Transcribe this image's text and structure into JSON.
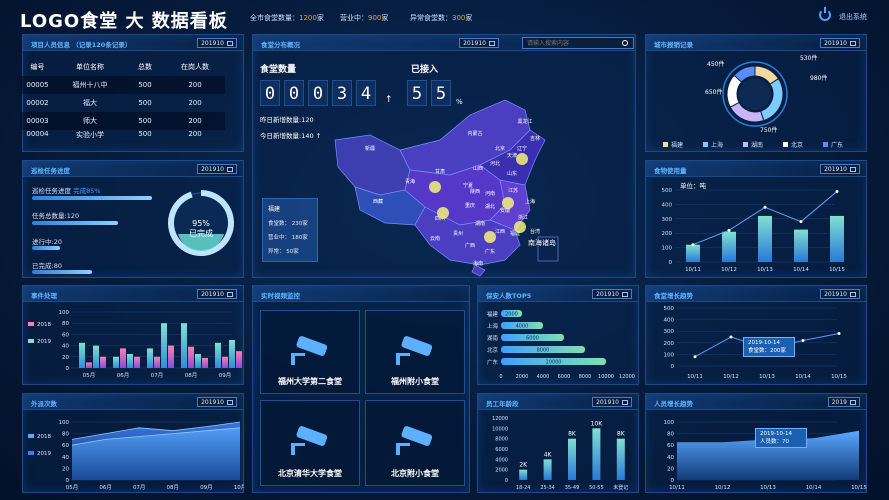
{
  "header": {
    "title": "LOGO食堂 大 数据看板",
    "stats": [
      {
        "label": "全市食堂数量：",
        "value": "1200",
        "unit": "家"
      },
      {
        "label": "营业中：",
        "value": "900",
        "unit": "家"
      },
      {
        "label": "异常食堂数：",
        "value": "300",
        "unit": "家"
      }
    ],
    "logout_label": "退出系统"
  },
  "personnel": {
    "title": "项目人员信息 （记录120条记录）",
    "date": "201910",
    "columns": [
      "编号",
      "单位名称",
      "总数",
      "在岗人数"
    ],
    "rows": [
      [
        "00005",
        "福州十八中",
        "500",
        "200"
      ],
      [
        "00002",
        "福大",
        "500",
        "200"
      ],
      [
        "00003",
        "师大",
        "500",
        "200"
      ],
      [
        "00004",
        "实验小学",
        "500",
        "200"
      ]
    ]
  },
  "inspection": {
    "title": "巡检任务进度",
    "date": "201910",
    "items": [
      {
        "label": "巡检任务进度",
        "extra": "完成85%",
        "progress": 0.85
      },
      {
        "label": "任务总数量:120",
        "extra": "",
        "progress": 0.72
      },
      {
        "label": "进行中:20",
        "extra": "",
        "progress": 0.22
      },
      {
        "label": "已完成:80",
        "extra": "",
        "progress": 0.5
      }
    ],
    "gauge_percent": "95%",
    "gauge_label": "已完成",
    "gauge_value": 0.95
  },
  "map_panel": {
    "title": "食堂分布概况",
    "date": "201910",
    "search_placeholder": "请输入搜索内容",
    "count_label": "食堂数量",
    "digits": [
      "0",
      "0",
      "0",
      "3",
      "4"
    ],
    "arrow": "↑",
    "access_label": "已接入",
    "access_digits": [
      "5",
      "5"
    ],
    "access_unit": "%",
    "yesterday": "昨日新增数量:120",
    "today": "今日新增数量:140",
    "today_arrow": "↑",
    "info_box": {
      "region": "福建",
      "lines": [
        "食堂数：  230家",
        "营业中：  180家",
        "异常：  50家"
      ]
    },
    "provinces": [
      "黑龙江",
      "吉林",
      "辽宁",
      "北京",
      "天津",
      "内蒙古",
      "新疆",
      "西藏",
      "青海",
      "甘肃",
      "宁夏",
      "山西",
      "河北",
      "山东",
      "陕西",
      "河南",
      "四川",
      "重庆",
      "湖北",
      "江苏",
      "安徽",
      "上海",
      "浙江",
      "湖南",
      "江西",
      "贵州",
      "云南",
      "广西",
      "广东",
      "福建",
      "台湾",
      "海南",
      "南海诸岛"
    ]
  },
  "city_report": {
    "title": "城市报销记录",
    "date": "201910",
    "chart_data": {
      "type": "pie",
      "labels": [
        "福建",
        "上海",
        "湖南",
        "北京",
        "广东"
      ],
      "values": [
        530,
        980,
        750,
        650,
        450
      ],
      "value_labels": [
        "530件",
        "980件",
        "750件",
        "650件",
        "450件"
      ],
      "colors": [
        "#f5d7a0",
        "#7ecbff",
        "#c7b6f5",
        "#ffffff",
        "#5a8cff"
      ]
    }
  },
  "food_usage": {
    "title": "食物使用量",
    "date": "201910",
    "unit_label": "单位：",
    "unit": "吨",
    "chart_data": {
      "type": "bar",
      "categories": [
        "10/11",
        "10/12",
        "10/13",
        "10/14",
        "10/15"
      ],
      "values": [
        120,
        210,
        320,
        225,
        320
      ],
      "line_values": [
        120,
        220,
        380,
        280,
        490
      ],
      "ylim": [
        0,
        500
      ],
      "yticks": [
        0,
        100,
        200,
        300,
        400,
        500
      ]
    }
  },
  "events": {
    "title": "事件处理",
    "date": "201910",
    "chart_data": {
      "type": "bar",
      "categories": [
        "05月",
        "06月",
        "07月",
        "08月",
        "09月"
      ],
      "series": [
        {
          "name": "2018",
          "values": [
            40,
            25,
            80,
            25,
            50
          ]
        },
        {
          "name": "2019",
          "values": [
            20,
            20,
            40,
            18,
            30
          ]
        }
      ],
      "extra_bars": [
        [
          45,
          10
        ],
        [
          20,
          35
        ],
        [
          35,
          20
        ],
        [
          80,
          38
        ],
        [
          45,
          20
        ]
      ],
      "ylim": [
        0,
        100
      ],
      "yticks": [
        0,
        20,
        40,
        60,
        80,
        100
      ]
    }
  },
  "outings": {
    "title": "外派次数",
    "date": "201910",
    "chart_data": {
      "type": "area",
      "x": [
        "05月",
        "06月",
        "07月",
        "08月",
        "09月",
        "10月"
      ],
      "series": [
        {
          "name": "2018",
          "values": [
            70,
            80,
            90,
            85,
            92,
            100
          ]
        },
        {
          "name": "2019",
          "values": [
            60,
            70,
            75,
            80,
            85,
            90
          ]
        }
      ],
      "ylim": [
        0,
        100
      ],
      "yticks": [
        0,
        20,
        40,
        60,
        80,
        100
      ]
    }
  },
  "monitor": {
    "title": "实时视频监控",
    "cameras": [
      "福州大学第二食堂",
      "福州附小食堂",
      "北京清华大学食堂",
      "北京附小食堂"
    ]
  },
  "security": {
    "title": "保安人数TOP5",
    "date": "201910",
    "chart_data": {
      "type": "bar",
      "categories": [
        "福建",
        "上海",
        "湖南",
        "北京",
        "广东"
      ],
      "values": [
        2000,
        4000,
        6000,
        8000,
        10000
      ],
      "value_labels": [
        "2000",
        "4000",
        "6000",
        "8000",
        "10000"
      ],
      "xlim": [
        0,
        12000
      ],
      "xticks": [
        0,
        2000,
        4000,
        6000,
        8000,
        10000,
        12000
      ]
    }
  },
  "staff_age": {
    "title": "员工年龄段",
    "date": "201910",
    "chart_data": {
      "type": "bar",
      "categories": [
        "18-24",
        "25-34",
        "35-49",
        "50-55",
        "未登记"
      ],
      "values": [
        2000,
        4000,
        8000,
        10000,
        8000
      ],
      "value_labels": [
        "2K",
        "4K",
        "8K",
        "10K",
        "8K"
      ],
      "ylim": [
        0,
        12000
      ],
      "yticks": [
        0,
        2000,
        4000,
        6000,
        8000,
        10000,
        12000
      ]
    }
  },
  "canteen_trend": {
    "title": "食堂增长趋势",
    "date": "201910",
    "tooltip_date": "2019-10-14",
    "tooltip_value": "食堂数：200家",
    "chart_data": {
      "type": "line",
      "x": [
        "10/11",
        "10/12",
        "10/13",
        "10/14",
        "10/15"
      ],
      "values": [
        80,
        250,
        150,
        220,
        280
      ],
      "ylim": [
        0,
        500
      ],
      "yticks": [
        0,
        100,
        200,
        300,
        400,
        500
      ]
    }
  },
  "people_trend": {
    "title": "人员增长趋势",
    "date": "2019",
    "tooltip_date": "2019-10-14",
    "tooltip_value": "人员数：70",
    "chart_data": {
      "type": "area",
      "x": [
        "10/11",
        "10/12",
        "10/13",
        "10/14",
        "10/15"
      ],
      "values": [
        65,
        65,
        70,
        72,
        85
      ],
      "ylim": [
        0,
        100
      ],
      "yticks": [
        0,
        20,
        40,
        60,
        80,
        100
      ]
    }
  }
}
